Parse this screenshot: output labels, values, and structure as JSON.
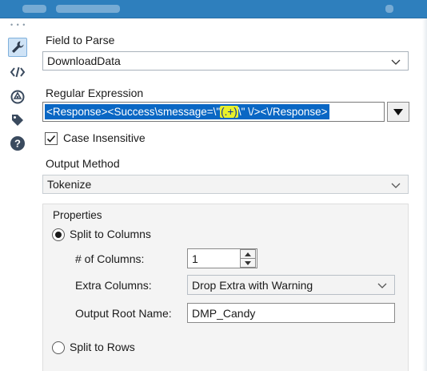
{
  "colors": {
    "titlebar": "#2e7fbd",
    "selection": "#0a67c4",
    "highlight": "#e8f02a",
    "sidebar_icon": "#3a4a5e"
  },
  "sidebar": {
    "icons": [
      "wrench-icon",
      "code-icon",
      "target-icon",
      "tag-icon",
      "help-icon"
    ]
  },
  "field_to_parse": {
    "label": "Field to Parse",
    "value": "DownloadData"
  },
  "regular_expression": {
    "label": "Regular Expression",
    "value_before": "<Response><Success\\smessage=\\\"",
    "value_highlight": "(.+)",
    "value_after": "\\\" \\/><\\/Response>"
  },
  "case_insensitive": {
    "label": "Case Insensitive",
    "checked": true
  },
  "output_method": {
    "label": "Output Method",
    "value": "Tokenize"
  },
  "properties": {
    "label": "Properties",
    "split_to_columns": {
      "label": "Split to Columns",
      "selected": true
    },
    "num_columns": {
      "label": "# of Columns:",
      "value": "1"
    },
    "extra_columns": {
      "label": "Extra Columns:",
      "value": "Drop Extra with Warning"
    },
    "output_root_name": {
      "label": "Output Root Name:",
      "value": "DMP_Candy"
    },
    "split_to_rows": {
      "label": "Split to Rows",
      "selected": false
    }
  }
}
